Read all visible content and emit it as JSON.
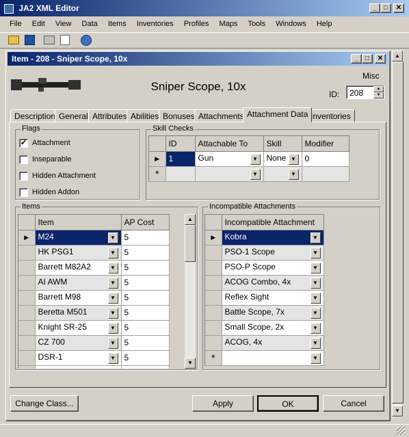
{
  "app": {
    "title": "JA2 XML Editor"
  },
  "menu": [
    "File",
    "Edit",
    "View",
    "Data",
    "Items",
    "Inventories",
    "Profiles",
    "Maps",
    "Tools",
    "Windows",
    "Help"
  ],
  "child": {
    "title": "Item - 208 - Sniper Scope, 10x"
  },
  "item": {
    "name": "Sniper Scope, 10x",
    "category": "Misc",
    "id_label": "ID:",
    "id_value": "208"
  },
  "tabs": [
    "Description",
    "General",
    "Attributes",
    "Abilities",
    "Bonuses",
    "Attachments",
    "Attachment Data",
    "Inventories"
  ],
  "flags": {
    "label": "Flags",
    "items": [
      {
        "label": "Attachment",
        "checked": "✔"
      },
      {
        "label": "Inseparable",
        "checked": ""
      },
      {
        "label": "Hidden Attachment",
        "checked": ""
      },
      {
        "label": "Hidden Addon",
        "checked": ""
      }
    ]
  },
  "skill_checks": {
    "label": "Skill Checks",
    "headers": [
      "ID",
      "Attachable To",
      "Skill",
      "Modifier"
    ],
    "row": {
      "id": "1",
      "attachable": "Gun",
      "skill": "None",
      "modifier": "0"
    }
  },
  "items_group": {
    "label": "Items",
    "headers": [
      "Item",
      "AP Cost"
    ],
    "rows": [
      {
        "name": "M24",
        "ap": "5"
      },
      {
        "name": "HK PSG1",
        "ap": "5"
      },
      {
        "name": "Barrett M82A2",
        "ap": "5"
      },
      {
        "name": "AI AWM",
        "ap": "5"
      },
      {
        "name": "Barrett M98",
        "ap": "5"
      },
      {
        "name": "Beretta M501",
        "ap": "5"
      },
      {
        "name": "Knight SR-25",
        "ap": "5"
      },
      {
        "name": "CZ 700",
        "ap": "5"
      },
      {
        "name": "DSR-1",
        "ap": "5"
      }
    ]
  },
  "incompatible": {
    "label": "Incompatible Attachments",
    "header": "Incompatible Attachment",
    "rows": [
      "Kobra",
      "PSO-1 Scope",
      "PSO-P Scope",
      "ACOG Combo, 4x",
      "Reflex Sight",
      "Battle Scope, 7x",
      "Small Scope, 2x",
      "ACOG, 4x"
    ]
  },
  "buttons": {
    "change_class": "Change Class...",
    "apply": "Apply",
    "ok": "OK",
    "cancel": "Cancel"
  },
  "glyphs": {
    "new_row": "*",
    "current_row": "▶",
    "dropdown": "▼",
    "up": "▲",
    "down": "▼",
    "min": "_",
    "max": "□",
    "close": "✕"
  }
}
